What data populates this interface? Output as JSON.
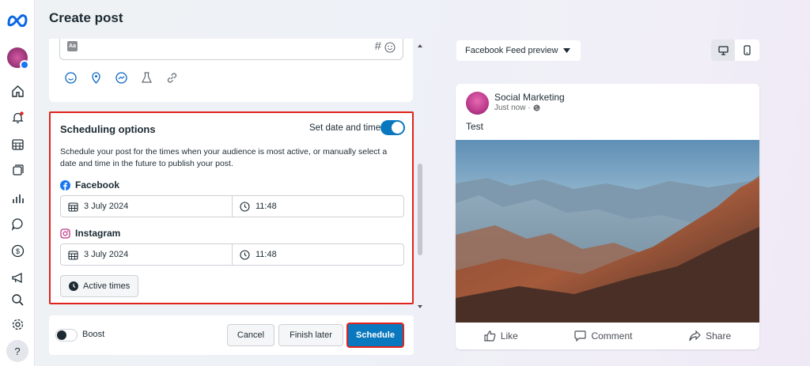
{
  "page": {
    "title": "Create post"
  },
  "sidebar": {
    "items": [
      "meta-logo",
      "account-avatar",
      "home",
      "notifications",
      "planner",
      "content",
      "insights",
      "inbox",
      "monetization",
      "ads",
      "search",
      "settings",
      "help"
    ]
  },
  "composer": {
    "hashtag_symbol": "#",
    "aa_label": "Aa"
  },
  "scheduling": {
    "title": "Scheduling options",
    "toggle_label": "Set date and time",
    "toggle_on": true,
    "description": "Schedule your post for the times when your audience is most active, or manually select a date and time in the future to publish your post.",
    "platforms": [
      {
        "name": "Facebook",
        "date": "3 July 2024",
        "time": "11:48"
      },
      {
        "name": "Instagram",
        "date": "3 July 2024",
        "time": "11:48"
      }
    ],
    "active_times_label": "Active times"
  },
  "footer": {
    "boost_label": "Boost",
    "cancel_label": "Cancel",
    "finish_later_label": "Finish later",
    "schedule_label": "Schedule"
  },
  "preview": {
    "dropdown_label": "Facebook Feed preview",
    "page_name": "Social Marketing",
    "post_time": "Just now ·",
    "post_text": "Test",
    "like_label": "Like",
    "comment_label": "Comment",
    "share_label": "Share"
  },
  "colors": {
    "accent": "#0a78be",
    "highlight": "#e0221c"
  }
}
